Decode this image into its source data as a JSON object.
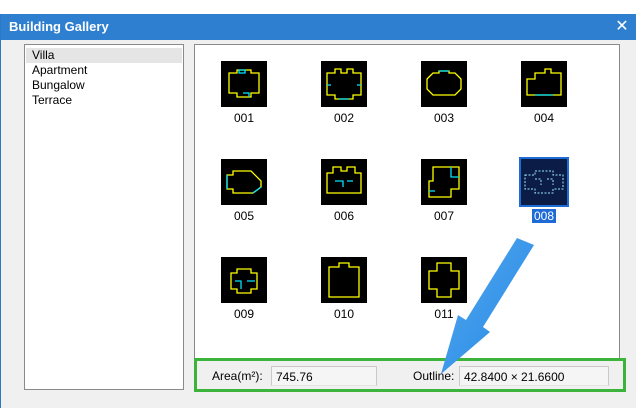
{
  "window": {
    "title": "Building Gallery",
    "close_glyph": "✕"
  },
  "categories": [
    {
      "label": "Villa",
      "selected": true
    },
    {
      "label": "Apartment",
      "selected": false
    },
    {
      "label": "Bungalow",
      "selected": false
    },
    {
      "label": "Terrace",
      "selected": false
    }
  ],
  "thumbnails": [
    {
      "label": "001",
      "selected": false
    },
    {
      "label": "002",
      "selected": false
    },
    {
      "label": "003",
      "selected": false
    },
    {
      "label": "004",
      "selected": false
    },
    {
      "label": "005",
      "selected": false
    },
    {
      "label": "006",
      "selected": false
    },
    {
      "label": "007",
      "selected": false
    },
    {
      "label": "008",
      "selected": true
    },
    {
      "label": "009",
      "selected": false
    },
    {
      "label": "010",
      "selected": false
    },
    {
      "label": "011",
      "selected": false
    }
  ],
  "status": {
    "area_label": "Area(m²):",
    "area_value": "745.76",
    "outline_label": "Outline:",
    "outline_value": "42.8400 × 21.6600"
  },
  "colors": {
    "titlebar": "#2f7fd0",
    "selection": "#1f6bd6",
    "highlight_border": "#3cb43c",
    "outline_yellow": "#ffff00",
    "outline_cyan": "#00e5ff",
    "arrow": "#1e88e5"
  }
}
